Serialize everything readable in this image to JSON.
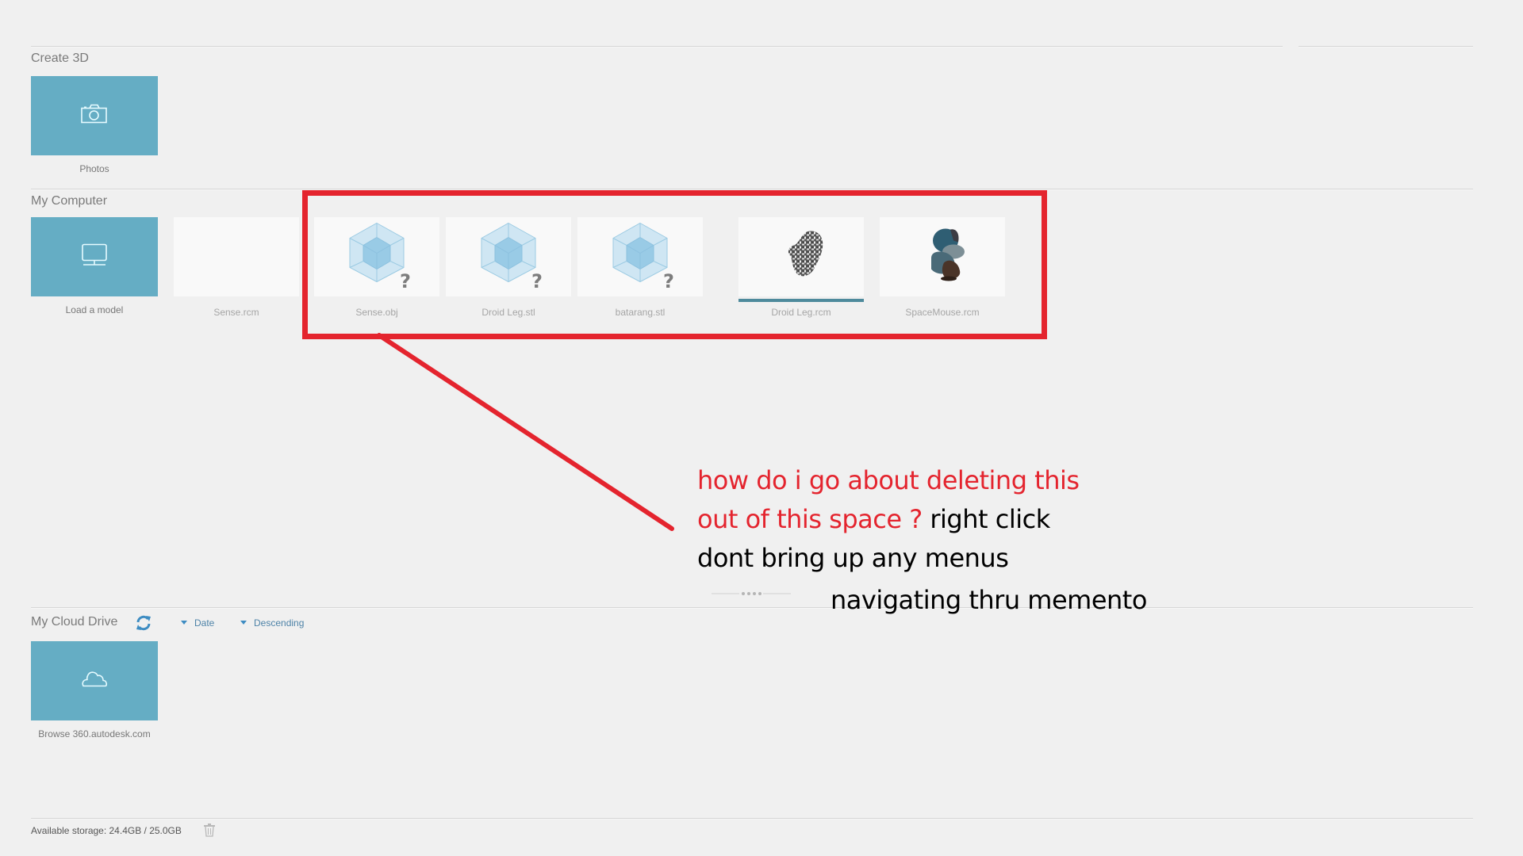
{
  "sections": {
    "create3d": {
      "title": "Create 3D",
      "tiles": [
        {
          "label": "Photos",
          "icon": "camera-icon"
        }
      ]
    },
    "my_computer": {
      "title": "My Computer",
      "load_tile": {
        "label": "Load a model",
        "icon": "monitor-icon"
      },
      "files": [
        {
          "name": "Sense.rcm",
          "thumbnail": "blank"
        },
        {
          "name": "Sense.obj",
          "thumbnail": "cube-unknown-icon"
        },
        {
          "name": "Droid Leg.stl",
          "thumbnail": "cube-unknown-icon"
        },
        {
          "name": "batarang.stl",
          "thumbnail": "cube-unknown-icon"
        },
        {
          "name": "Droid Leg.rcm",
          "thumbnail": "scan-mesh-grey",
          "selected": true
        },
        {
          "name": "SpaceMouse.rcm",
          "thumbnail": "scan-mesh-color"
        }
      ]
    },
    "cloud_drive": {
      "title": "My Cloud Drive",
      "refresh_icon": "refresh-icon",
      "sort_field": "Date",
      "sort_order": "Descending",
      "tile": {
        "label": "Browse 360.autodesk.com",
        "icon": "cloud-icon"
      }
    }
  },
  "footer": {
    "storage_text": "Available storage: 24.4GB / 25.0GB",
    "trash_icon": "trash-icon"
  },
  "annotation": {
    "line1_red": "how do i go about deleting this",
    "line2_red": "out of this space ?",
    "line2_black": " right click",
    "line3_black": "dont bring up any menus",
    "line4_black": "navigating thru memento",
    "highlight_color": "#e4242e"
  },
  "colors": {
    "tile_accent": "#65adc4",
    "selection_bar": "#4e8a9c",
    "link_blue": "#4e83a8",
    "background": "#f0f0f0"
  }
}
